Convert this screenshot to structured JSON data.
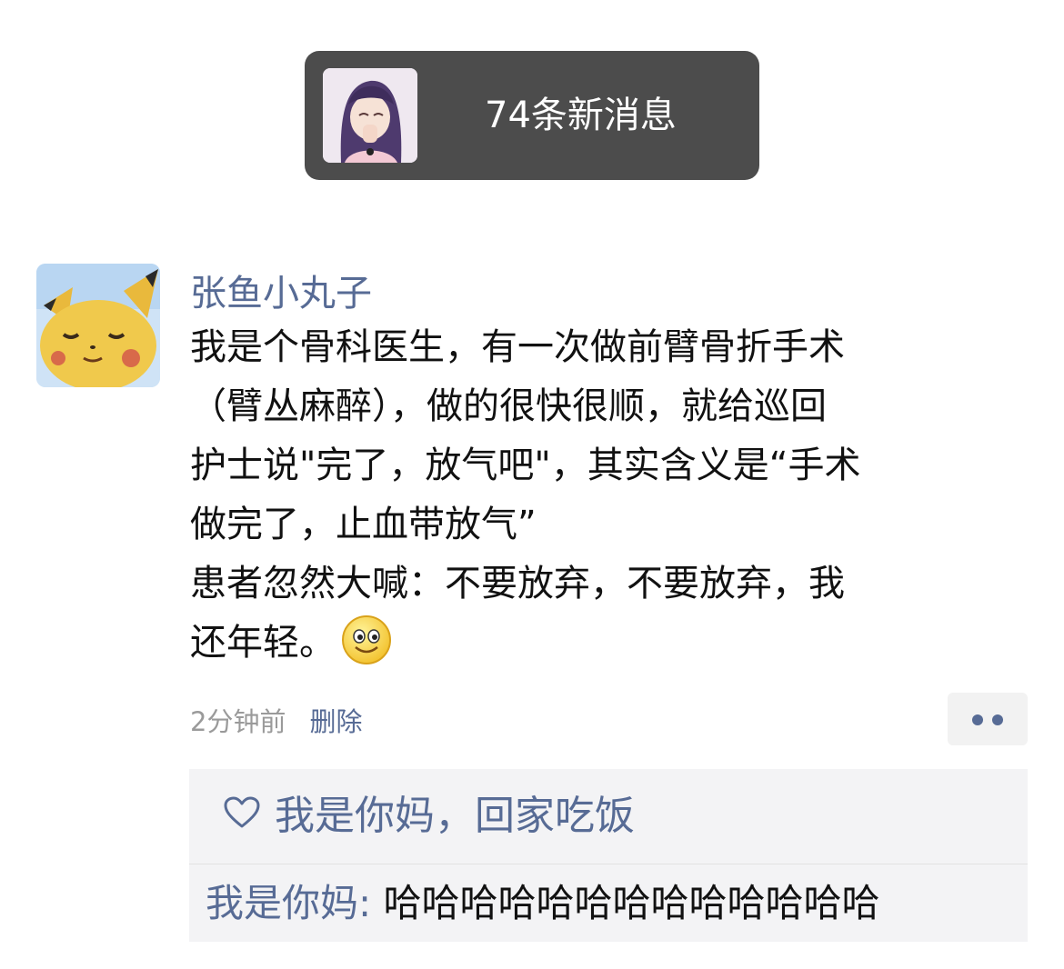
{
  "notification": {
    "text": "74条新消息",
    "avatar_icon": "anime-girl-avatar-icon"
  },
  "post": {
    "author": "张鱼小丸子",
    "avatar_icon": "pikachu-avatar-icon",
    "lines": [
      "我是个骨科医生，有一次做前臂骨折手术",
      "（臂丛麻醉），做的很快很顺，就给巡回",
      "护士说\"完了，放气吧\"，其实含义是“手术",
      "做完了，止血带放气”",
      "患者忽然大喊：不要放弃，不要放弃，我",
      "还年轻。"
    ],
    "emoji_icon": "smile-emoji-icon",
    "time": "2分钟前",
    "delete_label": "删除",
    "more_icon": "more-dots-icon"
  },
  "comments": {
    "like_icon": "heart-icon",
    "likes": "我是你妈，回家吃饭",
    "items": [
      {
        "author": "我是你妈",
        "separator": ": ",
        "text": "哈哈哈哈哈哈哈哈哈哈哈哈哈"
      }
    ]
  },
  "colors": {
    "link": "#576b95",
    "notification_bg": "#4c4c4c",
    "comment_bg": "#f3f3f5"
  }
}
